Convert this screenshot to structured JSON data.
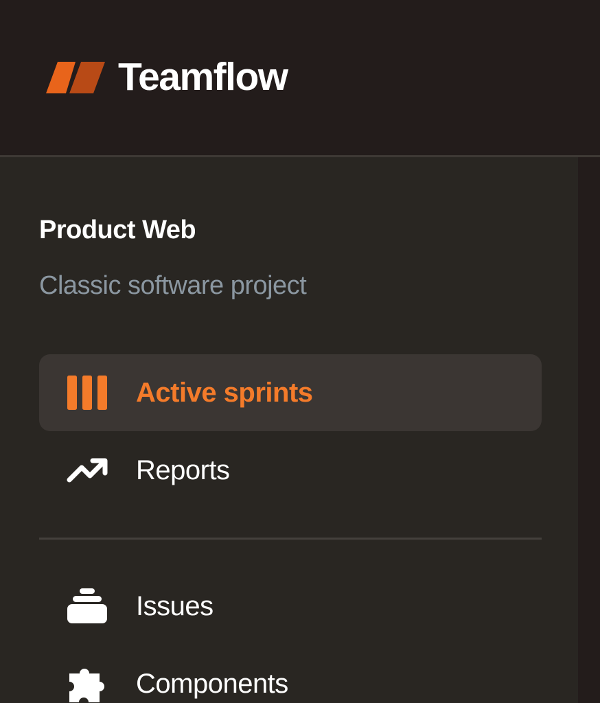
{
  "app": {
    "name": "Teamflow"
  },
  "project": {
    "name": "Product Web",
    "type": "Classic software project"
  },
  "nav": {
    "primary": [
      {
        "label": "Active sprints",
        "icon": "sprint-board-icon",
        "active": true
      },
      {
        "label": "Reports",
        "icon": "trending-up-icon",
        "active": false
      }
    ],
    "secondary": [
      {
        "label": "Issues",
        "icon": "stack-icon",
        "active": false
      },
      {
        "label": "Components",
        "icon": "puzzle-icon",
        "active": false
      }
    ]
  },
  "colors": {
    "accent": "#f47b2a",
    "background": "#231c1b",
    "sidebar": "#292622",
    "active_item": "#3b3633",
    "muted_text": "#8b97a1"
  }
}
